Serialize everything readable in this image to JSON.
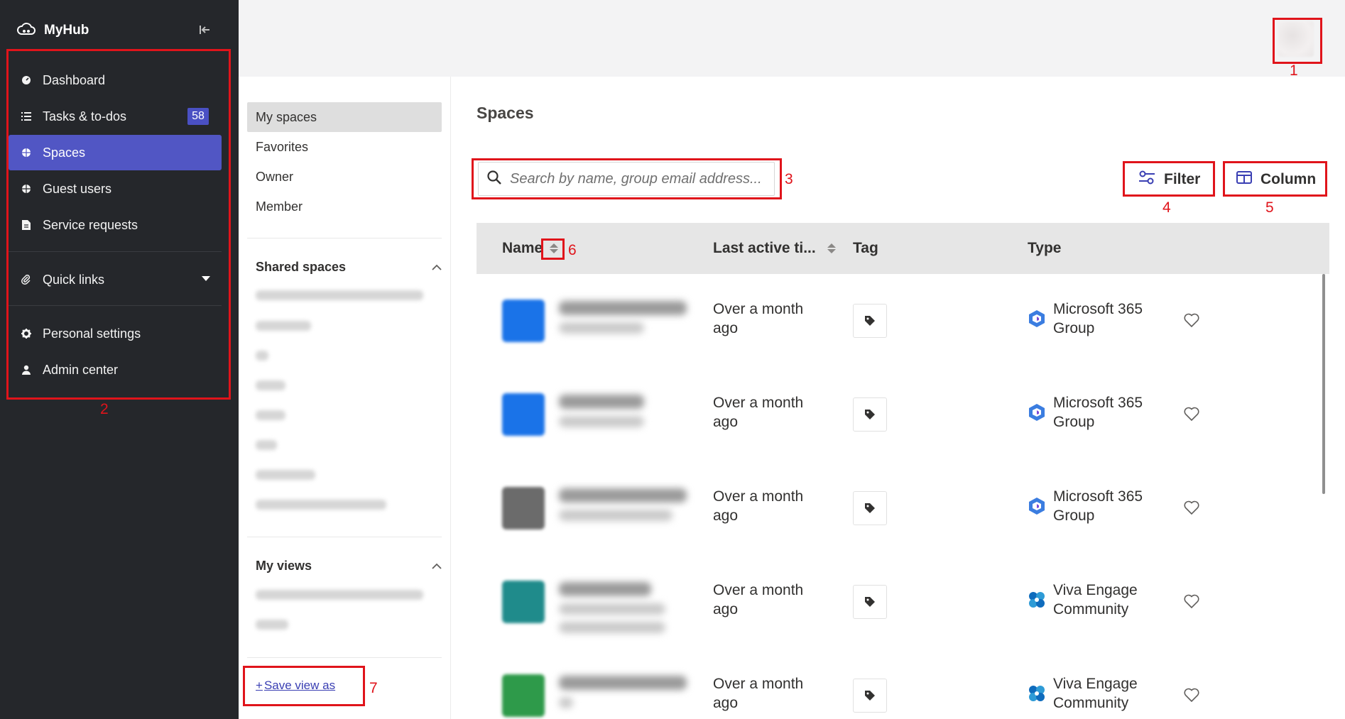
{
  "app": {
    "name": "MyHub"
  },
  "sidebar": {
    "items": [
      {
        "label": "Dashboard",
        "icon": "dashboard-icon"
      },
      {
        "label": "Tasks & to-dos",
        "icon": "tasks-icon",
        "badge": "58"
      },
      {
        "label": "Spaces",
        "icon": "spaces-icon",
        "active": true
      },
      {
        "label": "Guest users",
        "icon": "globe-icon"
      },
      {
        "label": "Service requests",
        "icon": "document-icon"
      }
    ],
    "quick_links": {
      "label": "Quick links",
      "icon": "paperclip-icon"
    },
    "bottom_items": [
      {
        "label": "Personal settings",
        "icon": "gear-icon"
      },
      {
        "label": "Admin center",
        "icon": "person-icon"
      }
    ]
  },
  "subnav": {
    "filters": [
      "My spaces",
      "Favorites",
      "Owner",
      "Member"
    ],
    "active_filter": "My spaces",
    "shared_spaces": {
      "title": "Shared spaces"
    },
    "my_views": {
      "title": "My views"
    },
    "save_view": {
      "icon": "+",
      "label": "Save view as"
    }
  },
  "main": {
    "title": "Spaces",
    "search": {
      "placeholder": "Search by name, group email address..."
    },
    "filter_button": "Filter",
    "column_button": "Column",
    "columns": {
      "name": "Name",
      "last_active": "Last active ti...",
      "tag": "Tag",
      "type": "Type"
    },
    "rows": [
      {
        "last_active": "Over a month ago",
        "type": "Microsoft 365 Group",
        "thumb_color": "#1a73e8"
      },
      {
        "last_active": "Over a month ago",
        "type": "Microsoft 365 Group",
        "thumb_color": "#1a73e8"
      },
      {
        "last_active": "Over a month ago",
        "type": "Microsoft 365 Group",
        "thumb_color": "#6b6b6b"
      },
      {
        "last_active": "Over a month ago",
        "type": "Viva Engage Community",
        "thumb_color": "#1f8b8b"
      },
      {
        "last_active": "Over a month ago",
        "type": "Viva Engage Community",
        "thumb_color": "#2e9a4a"
      }
    ]
  },
  "annotations": [
    "1",
    "2",
    "3",
    "4",
    "5",
    "6",
    "7"
  ],
  "colors": {
    "sidebar_bg": "#25272b",
    "accent": "#5156c4",
    "annotation": "#e0141b",
    "link": "#3a3fb3"
  }
}
